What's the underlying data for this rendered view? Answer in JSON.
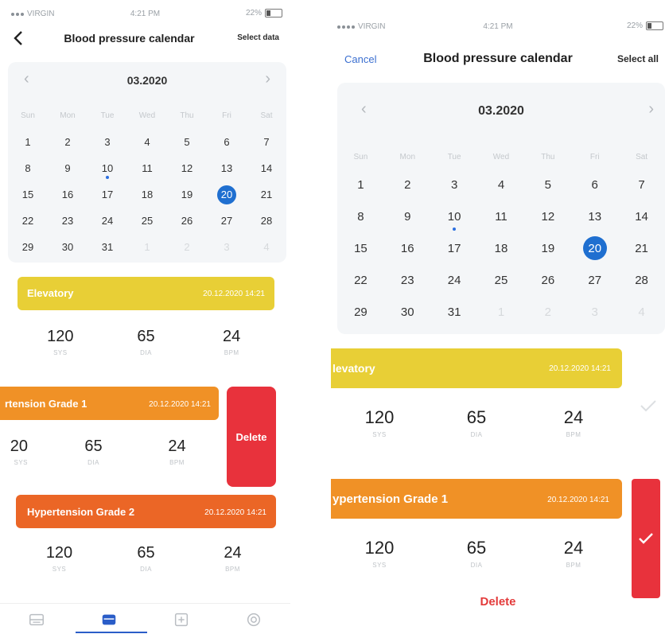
{
  "left": {
    "status": {
      "carrier": "VIRGIN",
      "time": "4:21 PM",
      "battery": "22%"
    },
    "nav": {
      "title": "Blood pressure calendar",
      "select": "Select data"
    },
    "calendar": {
      "month": "03.2020",
      "weekdays": [
        "Sun",
        "Mon",
        "Tue",
        "Wed",
        "Thu",
        "Fri",
        "Sat"
      ],
      "days": [
        "1",
        "2",
        "3",
        "4",
        "5",
        "6",
        "7",
        "8",
        "9",
        "10",
        "11",
        "12",
        "13",
        "14",
        "15",
        "16",
        "17",
        "18",
        "19",
        "20",
        "21",
        "22",
        "23",
        "24",
        "25",
        "26",
        "27",
        "28",
        "29",
        "30",
        "31",
        "1",
        "2",
        "3",
        "4"
      ]
    },
    "cards": [
      {
        "title": "Elevatory",
        "date": "20.12.2020 14:21",
        "values": [
          "120",
          "65",
          "24"
        ],
        "units": [
          "SYS",
          "DIA",
          "BPM"
        ]
      },
      {
        "title": "rtension Grade 1",
        "date": "20.12.2020 14:21",
        "values": [
          "20",
          "65",
          "24"
        ],
        "units": [
          "SYS",
          "DIA",
          "BPM"
        ]
      },
      {
        "title": "Hypertension Grade 2",
        "date": "20.12.2020 14:21",
        "values": [
          "120",
          "65",
          "24"
        ],
        "units": [
          "SYS",
          "DIA",
          "BPM"
        ]
      }
    ],
    "delete_label": "Delete"
  },
  "right": {
    "status": {
      "carrier": "VIRGIN",
      "time": "4:21 PM",
      "battery": "22%"
    },
    "nav": {
      "cancel": "Cancel",
      "title": "Blood pressure calendar",
      "select": "Select all"
    },
    "calendar": {
      "month": "03.2020",
      "weekdays": [
        "Sun",
        "Mon",
        "Tue",
        "Wed",
        "Thu",
        "Fri",
        "Sat"
      ],
      "days": [
        "1",
        "2",
        "3",
        "4",
        "5",
        "6",
        "7",
        "8",
        "9",
        "10",
        "11",
        "12",
        "13",
        "14",
        "15",
        "16",
        "17",
        "18",
        "19",
        "20",
        "21",
        "22",
        "23",
        "24",
        "25",
        "26",
        "27",
        "28",
        "29",
        "30",
        "31",
        "1",
        "2",
        "3",
        "4"
      ]
    },
    "cards": [
      {
        "title": "levatory",
        "date": "20.12.2020 14:21",
        "values": [
          "120",
          "65",
          "24"
        ],
        "units": [
          "SYS",
          "DIA",
          "BPM"
        ]
      },
      {
        "title": "ypertension Grade 1",
        "date": "20.12.2020 14:21",
        "values": [
          "120",
          "65",
          "24"
        ],
        "units": [
          "SYS",
          "DIA",
          "BPM"
        ]
      }
    ],
    "delete_label": "Delete"
  },
  "colors": {
    "selected_day": "#1f6fd0",
    "elevatory": "#e8cf36",
    "grade1": "#f09126",
    "grade2": "#eb6626",
    "delete": "#e8323c",
    "link": "#3b6fd0"
  },
  "icons": [
    "back-chevron-icon",
    "prev-month-icon",
    "next-month-icon",
    "list-tab-icon",
    "calendar-tab-icon",
    "add-tab-icon",
    "settings-tab-icon",
    "checkmark-icon"
  ]
}
